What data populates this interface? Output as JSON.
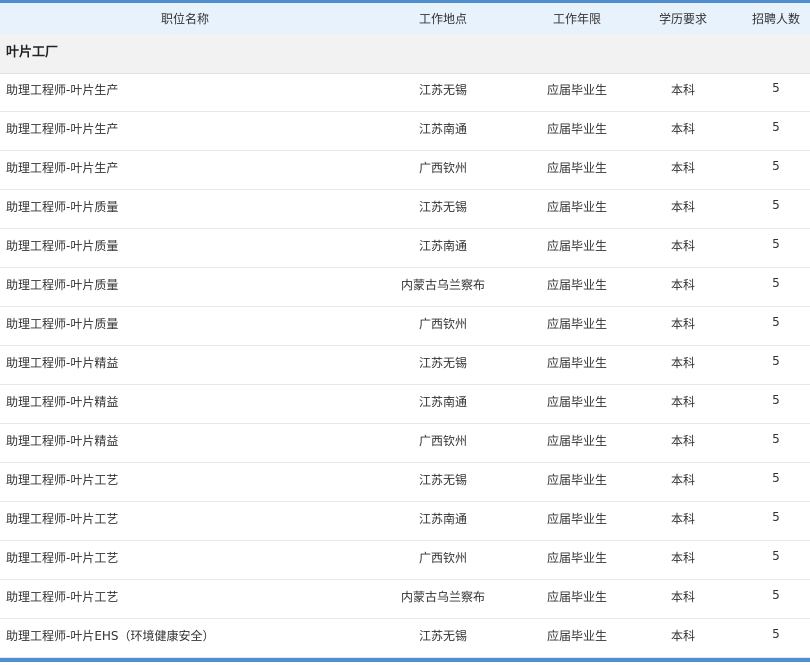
{
  "table": {
    "headers": {
      "name": "职位名称",
      "location": "工作地点",
      "years": "工作年限",
      "education": "学历要求",
      "count": "招聘人数"
    },
    "group": "叶片工厂",
    "rows": [
      {
        "name": "助理工程师-叶片生产",
        "location": "江苏无锡",
        "years": "应届毕业生",
        "education": "本科",
        "count": "5"
      },
      {
        "name": "助理工程师-叶片生产",
        "location": "江苏南通",
        "years": "应届毕业生",
        "education": "本科",
        "count": "5"
      },
      {
        "name": "助理工程师-叶片生产",
        "location": "广西钦州",
        "years": "应届毕业生",
        "education": "本科",
        "count": "5"
      },
      {
        "name": "助理工程师-叶片质量",
        "location": "江苏无锡",
        "years": "应届毕业生",
        "education": "本科",
        "count": "5"
      },
      {
        "name": "助理工程师-叶片质量",
        "location": "江苏南通",
        "years": "应届毕业生",
        "education": "本科",
        "count": "5"
      },
      {
        "name": "助理工程师-叶片质量",
        "location": "内蒙古乌兰察布",
        "years": "应届毕业生",
        "education": "本科",
        "count": "5"
      },
      {
        "name": "助理工程师-叶片质量",
        "location": "广西钦州",
        "years": "应届毕业生",
        "education": "本科",
        "count": "5"
      },
      {
        "name": "助理工程师-叶片精益",
        "location": "江苏无锡",
        "years": "应届毕业生",
        "education": "本科",
        "count": "5"
      },
      {
        "name": "助理工程师-叶片精益",
        "location": "江苏南通",
        "years": "应届毕业生",
        "education": "本科",
        "count": "5"
      },
      {
        "name": "助理工程师-叶片精益",
        "location": "广西钦州",
        "years": "应届毕业生",
        "education": "本科",
        "count": "5"
      },
      {
        "name": "助理工程师-叶片工艺",
        "location": "江苏无锡",
        "years": "应届毕业生",
        "education": "本科",
        "count": "5"
      },
      {
        "name": "助理工程师-叶片工艺",
        "location": "江苏南通",
        "years": "应届毕业生",
        "education": "本科",
        "count": "5"
      },
      {
        "name": "助理工程师-叶片工艺",
        "location": "广西钦州",
        "years": "应届毕业生",
        "education": "本科",
        "count": "5"
      },
      {
        "name": "助理工程师-叶片工艺",
        "location": "内蒙古乌兰察布",
        "years": "应届毕业生",
        "education": "本科",
        "count": "5"
      },
      {
        "name": "助理工程师-叶片EHS（环境健康安全）",
        "location": "江苏无锡",
        "years": "应届毕业生",
        "education": "本科",
        "count": "5"
      }
    ]
  },
  "colors": {
    "accent": "#4f8fd0",
    "header_bg": "#e8f2fc",
    "group_bg": "#f2f2f2"
  }
}
